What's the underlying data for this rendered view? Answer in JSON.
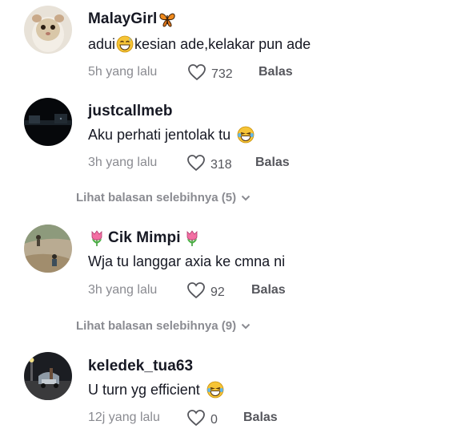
{
  "comments": [
    {
      "username": "MalayGirl",
      "username_icon": "butterfly-icon",
      "text_before": "adui",
      "text_after": "kesian ade,kelakar pun ade",
      "text_emoji": "grinning-sweat-emoji",
      "time": "5h yang lalu",
      "likes": "732",
      "reply": "Balas"
    },
    {
      "username": "justcallmeb",
      "text_before": "Aku perhati jentolak tu ",
      "text_emoji": "laughing-tears-emoji",
      "time": "3h yang lalu",
      "likes": "318",
      "reply": "Balas",
      "more_replies": "Lihat balasan selebihnya (5)"
    },
    {
      "username": "Cik Mimpi",
      "username_icon": "tulip-icon",
      "text_before": "Wja tu langgar axia ke cmna ni",
      "time": "3h yang lalu",
      "likes": "92",
      "reply": "Balas",
      "more_replies": "Lihat balasan selebihnya (9)"
    },
    {
      "username": "keledek_tua63",
      "text_before": "U turn yg efficient ",
      "text_emoji": "laughing-tears-emoji",
      "time": "12j yang lalu",
      "likes": "0",
      "reply": "Balas"
    }
  ],
  "colors": {
    "text": "#161823",
    "meta": "#8a8b91",
    "action": "#55565c"
  }
}
